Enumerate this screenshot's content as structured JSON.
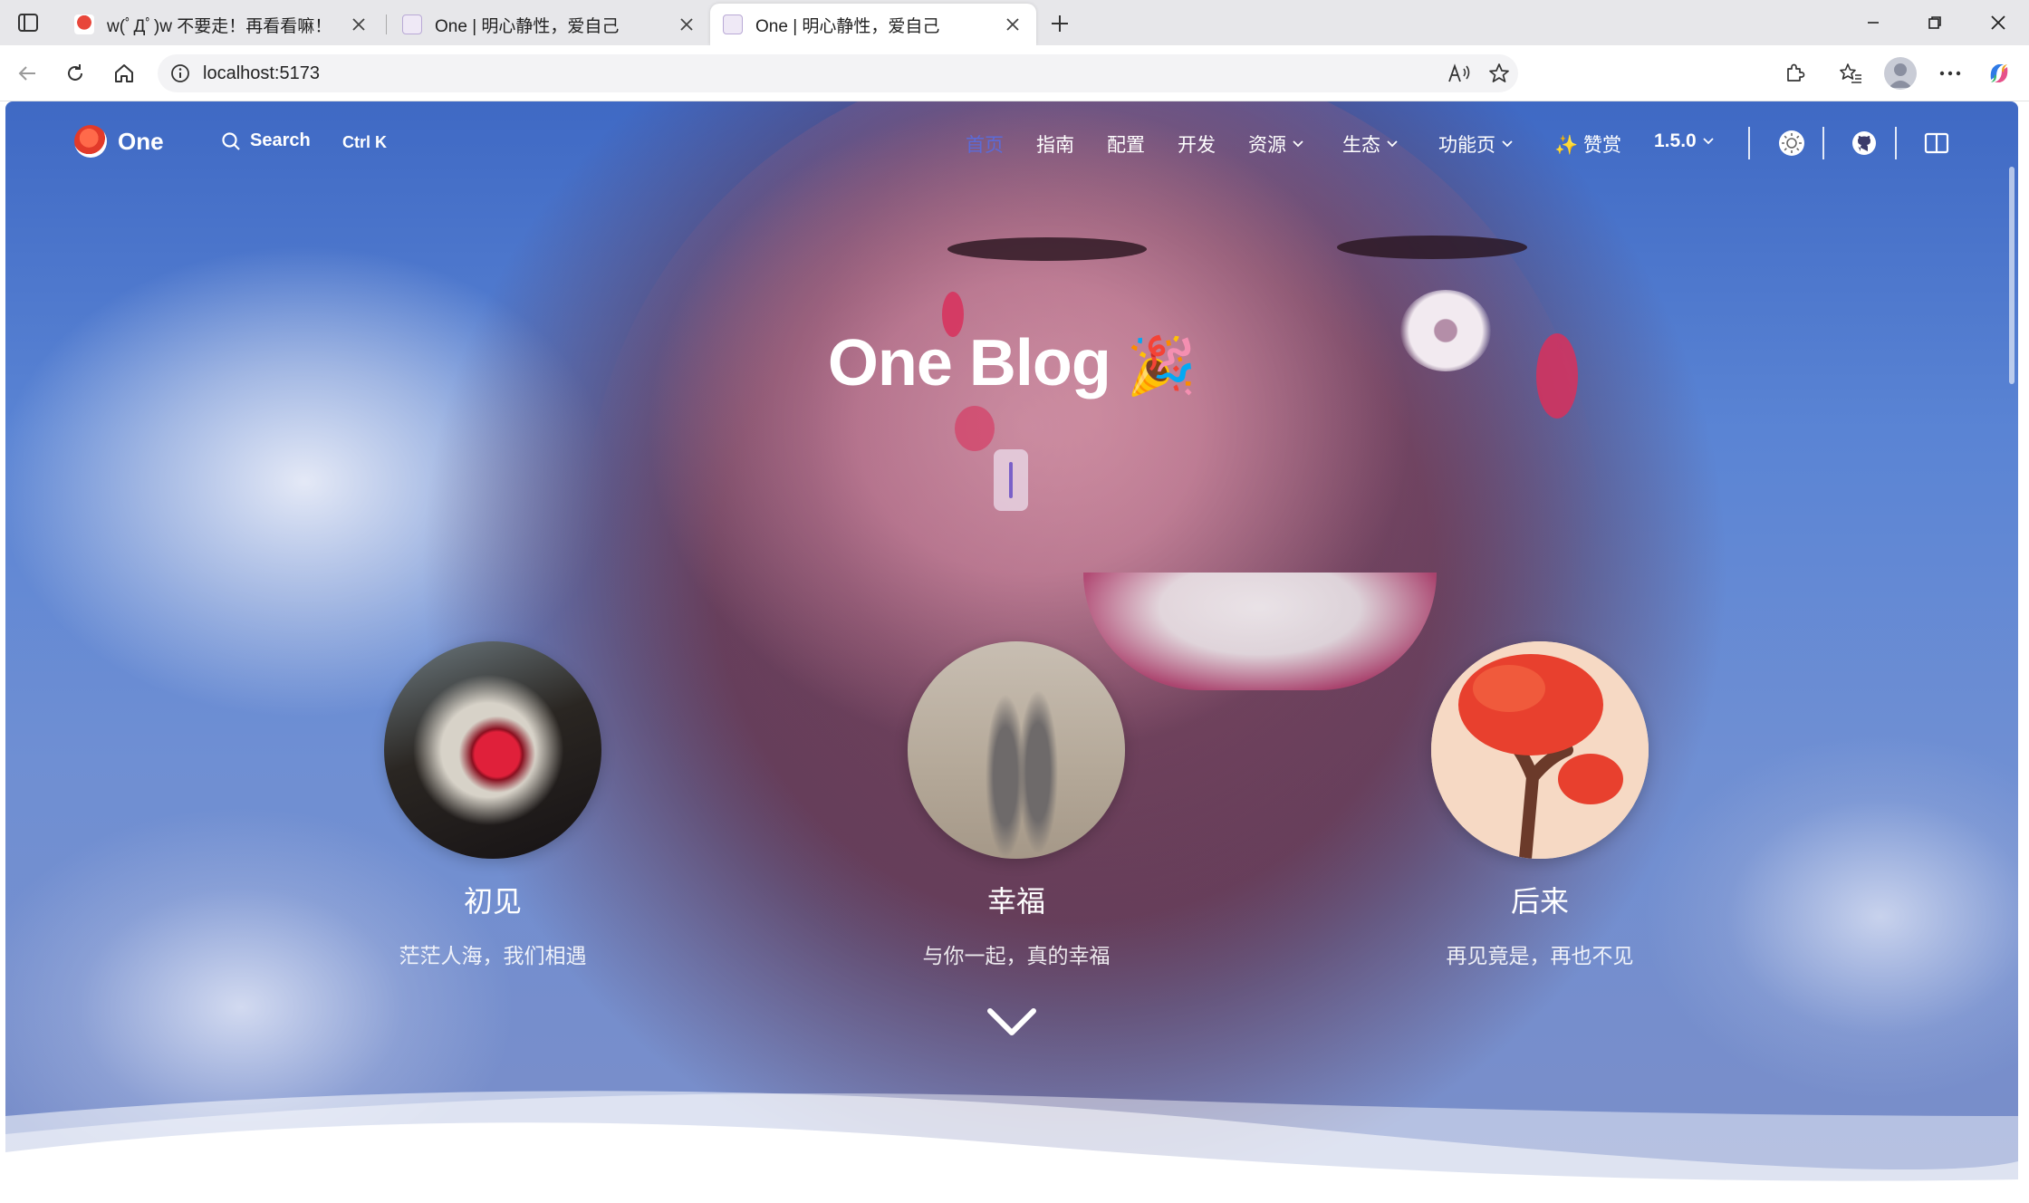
{
  "browser": {
    "tabs": [
      {
        "title": "w(ﾟДﾟ)w 不要走！再看看嘛！",
        "active": false
      },
      {
        "title": "One | 明心静性，爱自己",
        "active": false
      },
      {
        "title": "One | 明心静性，爱自己",
        "active": true
      }
    ],
    "url": "localhost:5173"
  },
  "nav": {
    "brand": "One",
    "search_label": "Search",
    "search_shortcut": "Ctrl K",
    "links": [
      {
        "label": "首页",
        "active": true
      },
      {
        "label": "指南"
      },
      {
        "label": "配置"
      },
      {
        "label": "开发"
      },
      {
        "label": "资源",
        "dropdown": true
      },
      {
        "label": "生态",
        "dropdown": true
      },
      {
        "label": "功能页",
        "dropdown": true
      },
      {
        "label": "✨ 赞赏"
      },
      {
        "label": "1.5.0",
        "dropdown": true
      }
    ]
  },
  "hero": {
    "title": "One Blog",
    "title_emoji": "🎉",
    "cards": [
      {
        "title": "初见",
        "subtitle": "茫茫人海，我们相遇"
      },
      {
        "title": "幸福",
        "subtitle": "与你一起，真的幸福"
      },
      {
        "title": "后来",
        "subtitle": "再见竟是，再也不见"
      }
    ]
  },
  "colors": {
    "accent": "#5b6bd8",
    "sky": "#5a84d4",
    "brand_red": "#e23a2a"
  }
}
